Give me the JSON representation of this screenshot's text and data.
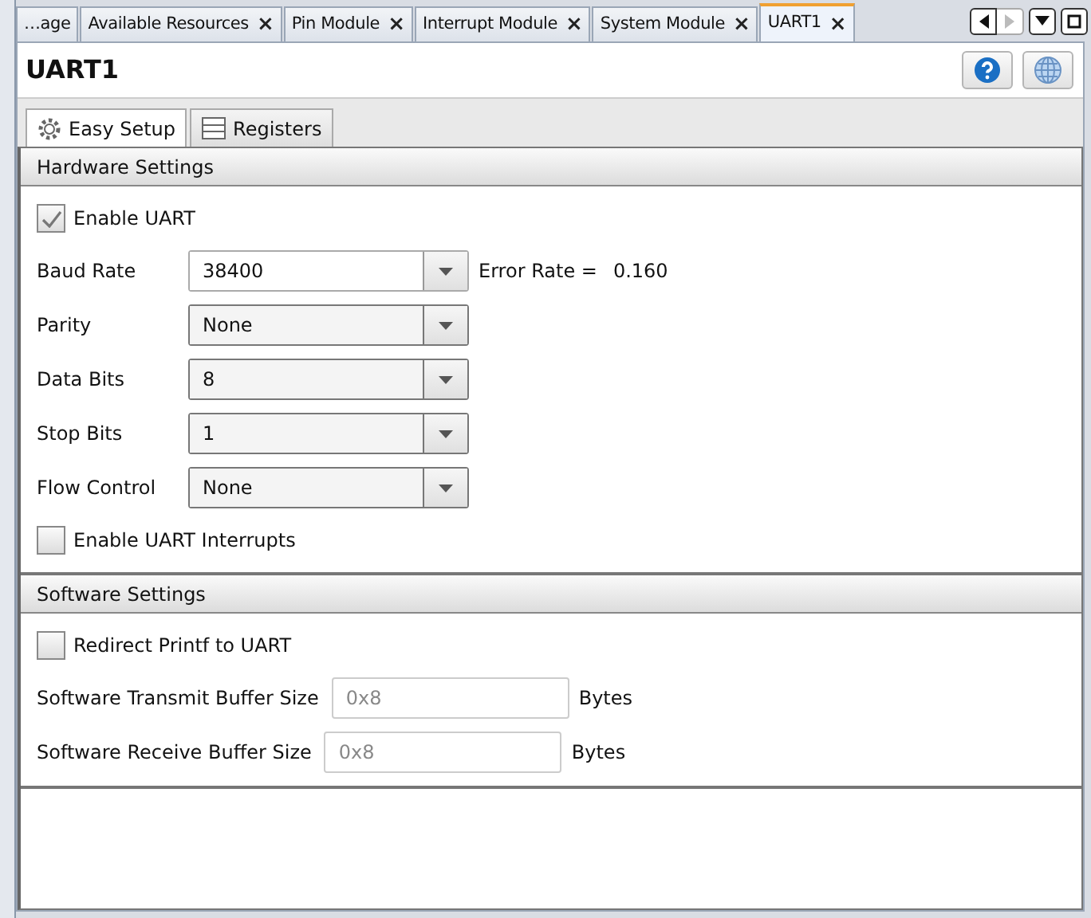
{
  "editor_tabs": [
    {
      "label": "…age",
      "selected": false,
      "closable": false
    },
    {
      "label": "Available Resources",
      "selected": false,
      "closable": true
    },
    {
      "label": "Pin Module",
      "selected": false,
      "closable": true
    },
    {
      "label": "Interrupt Module",
      "selected": false,
      "closable": true
    },
    {
      "label": "System Module",
      "selected": false,
      "closable": true
    },
    {
      "label": "UART1",
      "selected": true,
      "closable": true
    }
  ],
  "close_glyph": "×",
  "title": "UART1",
  "view_tabs": [
    {
      "label": "Easy Setup",
      "selected": true
    },
    {
      "label": "Registers",
      "selected": false
    }
  ],
  "sections": [
    {
      "title": "Hardware Settings",
      "items": [
        {
          "kind": "checkbox",
          "label": "Enable UART",
          "checked": true
        },
        {
          "kind": "combo",
          "label": "Baud Rate",
          "value": "38400",
          "editable": true,
          "note_label": "Error Rate =",
          "note_value": "0.160"
        },
        {
          "kind": "combo",
          "label": "Parity",
          "value": "None",
          "editable": false
        },
        {
          "kind": "combo",
          "label": "Data Bits",
          "value": "8",
          "editable": false
        },
        {
          "kind": "combo",
          "label": "Stop Bits",
          "value": "1",
          "editable": false
        },
        {
          "kind": "combo",
          "label": "Flow Control",
          "value": "None",
          "editable": false
        },
        {
          "kind": "checkbox",
          "label": "Enable UART Interrupts",
          "checked": false
        }
      ]
    },
    {
      "title": "Software Settings",
      "items": [
        {
          "kind": "checkbox",
          "label": "Redirect Printf to UART",
          "checked": false
        },
        {
          "kind": "text",
          "label": "Software Transmit Buffer Size",
          "placeholder": "0x8",
          "unit": "Bytes"
        },
        {
          "kind": "text",
          "label": "Software Receive Buffer Size",
          "placeholder": "0x8",
          "unit": "Bytes"
        }
      ]
    }
  ]
}
